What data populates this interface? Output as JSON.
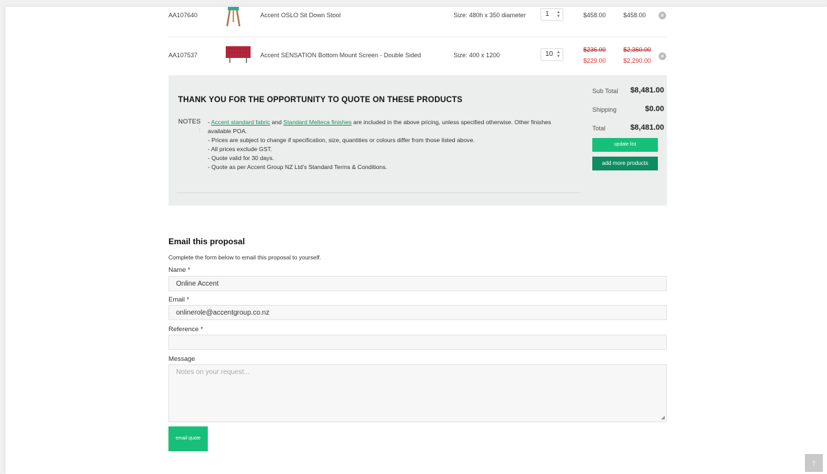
{
  "products": [
    {
      "code": "AA107640",
      "thumb": "stool-thumbnail",
      "name": "Accent OSLO Sit Down Stool",
      "size": "Size: 480h x 350 diameter",
      "qty": "1",
      "price": "$458.00",
      "total": "$458.00",
      "old_price": "",
      "old_total": ""
    },
    {
      "code": "AA107537",
      "thumb": "screen-thumbnail",
      "name": "Accent SENSATION Bottom Mount Screen - Double Sided",
      "size": "Size: 400 x 1200",
      "qty": "10",
      "price": "$229.00",
      "total": "$2,290.00",
      "old_price": "$236.00",
      "old_total": "$2,360.00"
    }
  ],
  "summary": {
    "heading": "THANK YOU FOR THE OPPORTUNITY TO QUOTE ON THESE PRODUCTS",
    "notes_label": "NOTES",
    "notes_colon": ":",
    "notes": {
      "link1": "Accent standard fabric",
      "and": " and ",
      "link2": "Standard Melteca finishes",
      "line1_rest": " are included in the above pricing, unless specified otherwise. Other finishes available POA.",
      "line1_prefix": "- ",
      "line2": "- Prices are subject to change if specification, size, quantities or colours differ from those listed above.",
      "line3": "- All prices exclude GST.",
      "line4": "- Quote valid for 30 days.",
      "line5": "- Quote as per Accent Group NZ Ltd's Standard Terms & Conditions."
    },
    "subtotal_label": "Sub Total",
    "subtotal": "$8,481.00",
    "shipping_label": "Shipping",
    "shipping": "$0.00",
    "total_label": "Total",
    "total": "$8,481.00",
    "update_label": "update list",
    "add_label": "add more products"
  },
  "form": {
    "title": "Email this proposal",
    "description": "Complete the form below to email this proposal to yourself.",
    "name_label": "Name",
    "email_label": "Email",
    "reference_label": "Reference",
    "message_label": "Message",
    "required_mark": "*",
    "name_value": "Online Accent",
    "email_value": "onlinerole@accentgroup.co.nz",
    "reference_value": "",
    "message_placeholder": "Notes on your request...",
    "submit_label": "email quote"
  },
  "icons": {
    "remove": "close-circle-icon",
    "back_to_top": "arrow-up-icon"
  },
  "colors": {
    "accent": "#17c07a",
    "accent_dark": "#0e8d63",
    "sale": "#e0312b",
    "link": "#1f8f5f"
  }
}
